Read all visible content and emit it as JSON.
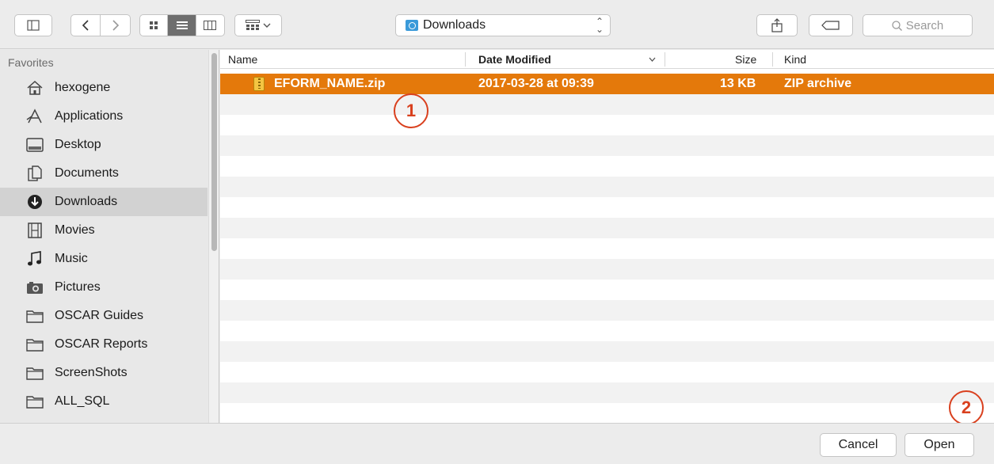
{
  "toolbar": {
    "location": "Downloads",
    "search_placeholder": "Search"
  },
  "sidebar": {
    "section_title": "Favorites",
    "items": [
      {
        "label": "hexogene",
        "icon": "home-icon"
      },
      {
        "label": "Applications",
        "icon": "applications-icon"
      },
      {
        "label": "Desktop",
        "icon": "desktop-icon"
      },
      {
        "label": "Documents",
        "icon": "documents-icon"
      },
      {
        "label": "Downloads",
        "icon": "downloads-icon",
        "selected": true
      },
      {
        "label": "Movies",
        "icon": "movies-icon"
      },
      {
        "label": "Music",
        "icon": "music-icon"
      },
      {
        "label": "Pictures",
        "icon": "pictures-icon"
      },
      {
        "label": "OSCAR Guides",
        "icon": "folder-icon"
      },
      {
        "label": "OSCAR Reports",
        "icon": "folder-icon"
      },
      {
        "label": "ScreenShots",
        "icon": "folder-icon"
      },
      {
        "label": "ALL_SQL",
        "icon": "folder-icon"
      }
    ]
  },
  "list": {
    "columns": {
      "name": "Name",
      "date": "Date Modified",
      "size": "Size",
      "kind": "Kind"
    },
    "rows": [
      {
        "name": "EFORM_NAME.zip",
        "date": "2017-03-28 at 09:39",
        "size": "13 KB",
        "kind": "ZIP archive",
        "selected": true
      }
    ]
  },
  "annotations": {
    "marker_1": "1",
    "marker_2": "2"
  },
  "footer": {
    "cancel": "Cancel",
    "open": "Open"
  },
  "colors": {
    "selection": "#e4790b",
    "annotation": "#d9401e"
  }
}
